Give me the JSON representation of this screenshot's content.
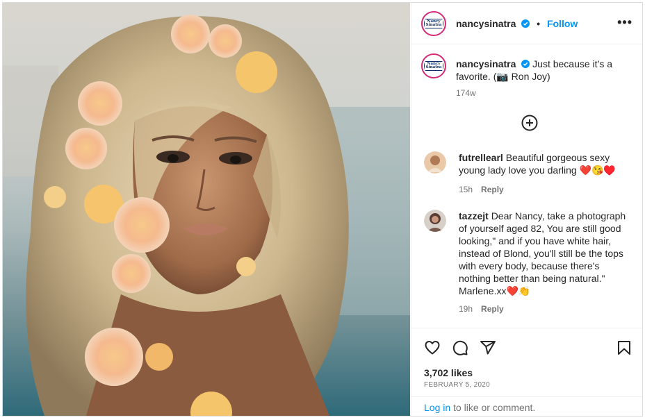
{
  "post": {
    "username": "nancysinatra",
    "dot": "•",
    "follow_label": "Follow",
    "more_label": "•••",
    "avatar_text": "Nancy Sinatra",
    "caption_username": "nancysinatra",
    "caption_text": "Just because it’s a favorite. (📷 Ron Joy)",
    "caption_time": "174w"
  },
  "comments": [
    {
      "username": "futrellearl",
      "text": "Beautiful gorgeous sexy young lady love you darling ❤️😘♥️",
      "time": "15h",
      "reply_label": "Reply"
    },
    {
      "username": "tazzejt",
      "text": "Dear Nancy, take a photograph of yourself aged 82, You are still good looking,\" and if you have white hair, instead of Blond, you'll still be the tops with every body, because there's nothing better than being natural.\" Marlene.xx❤️👏",
      "time": "19h",
      "reply_label": "Reply"
    }
  ],
  "footer": {
    "likes": "3,702 likes",
    "date": "FEBRUARY 5, 2020",
    "login_link": "Log in",
    "login_rest": " to like or comment."
  },
  "icons": {
    "verified": "verified-badge-icon",
    "add_comment": "plus-circle-icon",
    "like": "heart-icon",
    "comment": "comment-bubble-icon",
    "share": "paper-plane-icon",
    "save": "bookmark-icon"
  },
  "colors": {
    "accent": "#0095f6",
    "text": "#262626",
    "muted": "#737373",
    "border": "#dbdbdb",
    "ring": "#d62976"
  }
}
